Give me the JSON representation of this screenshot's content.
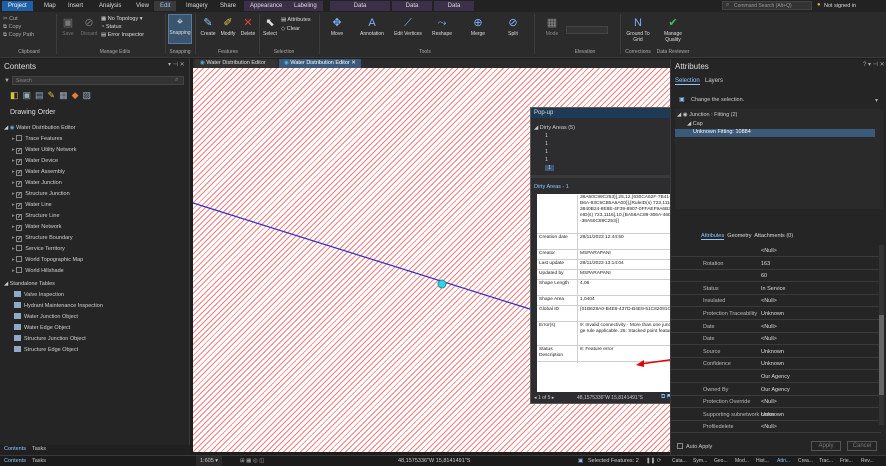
{
  "tabs": [
    "Project",
    "Map",
    "Insert",
    "Analysis",
    "View",
    "Edit",
    "Imagery",
    "Share",
    "Appearance",
    "Labeling",
    "Data",
    "Data",
    "Data"
  ],
  "search_placeholder": "Command Search (Alt+Q)",
  "user": "Not signed in",
  "ribbon": {
    "clipboard": {
      "items": [
        "Cut",
        "Copy",
        "Copy Path"
      ],
      "paste": "Paste",
      "label": "Clipboard"
    },
    "manage_edits": {
      "save": "Save",
      "discard": "Discard",
      "topology": "No Topology",
      "status": "Status",
      "error_inspector": "Error Inspector",
      "label": "Manage Edits"
    },
    "snapping": {
      "btn": "Snapping",
      "label": "Snapping"
    },
    "features": {
      "create": "Create",
      "modify": "Modify",
      "delete": "Delete",
      "label": "Features"
    },
    "selection": {
      "select": "Select",
      "attributes": "Attributes",
      "clear": "Clear",
      "label": "Selection"
    },
    "tools": {
      "items": [
        "Move",
        "Annotation",
        "Edit Vertices",
        "Reshape",
        "Merge",
        "Split"
      ],
      "label": "Tools"
    },
    "elevation": {
      "mode": "Mode",
      "label": "Elevation"
    },
    "corrections": {
      "ground": "Ground To Grid",
      "label": "Corrections"
    },
    "data_reviewer": {
      "manage": "Manage Quality",
      "label": "Data Reviewer"
    }
  },
  "contents": {
    "title": "Contents",
    "search_placeholder": "Search",
    "drawing_order": "Drawing Order",
    "map_name": "Water Distribution Editor",
    "layers": [
      {
        "name": "Trace Features",
        "checked": false
      },
      {
        "name": "Water Utility Network",
        "checked": true
      },
      {
        "name": "Water Device",
        "checked": true
      },
      {
        "name": "Water Assembly",
        "checked": true
      },
      {
        "name": "Water Junction",
        "checked": true
      },
      {
        "name": "Structure Junction",
        "checked": true
      },
      {
        "name": "Water Line",
        "checked": true
      },
      {
        "name": "Structure Line",
        "checked": true
      },
      {
        "name": "Water Network",
        "checked": true
      },
      {
        "name": "Structure Boundary",
        "checked": true
      },
      {
        "name": "Service Territory",
        "checked": false
      },
      {
        "name": "World Topographic Map",
        "checked": false
      },
      {
        "name": "World Hillshade",
        "checked": false
      }
    ],
    "standalone_title": "Standalone Tables",
    "tables": [
      "Valve Inspection",
      "Hydrant Maintenance Inspection",
      "Water Junction Object",
      "Water Edge Object",
      "Structure Junction Object",
      "Structure Edge Object"
    ],
    "bottom_tabs": [
      "Contents",
      "Tasks"
    ]
  },
  "map_tabs": [
    "Water Distribution Editor",
    "Water Distribution Editor"
  ],
  "popup": {
    "title": "Pop-up",
    "group": "Dirty Areas  (5)",
    "items": [
      "1",
      "1",
      "1",
      "1",
      "1"
    ],
    "section": "Dirty Areas - 1",
    "top_text": "38A50C89C253}],25,12,{630CA62F-7B41-4F52-8B6A-83C5CB5A6A00}],[RuleID(s) 723,1116],10,{E3840B24-8E8E-4F39-8907-0FFAEF9A6B3F}],[RuleID(s) 723,1116],10,{BA56AC89-306A-46DF-9027-38A50C89C253}]",
    "rows": [
      {
        "k": "Creation date",
        "v": "28/11/2023 12:44:50"
      },
      {
        "k": "Creator",
        "v": "MSPARAPANI"
      },
      {
        "k": "Last update",
        "v": "28/11/2023 13:14:04"
      },
      {
        "k": "Updated by",
        "v": "MSPARAPANI"
      },
      {
        "k": "Shape Length",
        "v": "4,06"
      },
      {
        "k": "Shape Area",
        "v": "1,0404"
      },
      {
        "k": "Global ID",
        "v": "{01B628A0-B4E6-437D-B4E9-51C82091C538}"
      },
      {
        "k": "Error(s)",
        "v": "9: Invalid connectivity - More than one junction edge rule applicable. 25: Stacked point features."
      },
      {
        "k": "Status Description",
        "v": "8: Feature error"
      }
    ],
    "nav": "1 of 5",
    "coords": "48,1575336\"W 15,8141491\"S"
  },
  "attributes": {
    "title": "Attributes",
    "tabs": [
      "Selection",
      "Layers"
    ],
    "change_selection": "Change the selection.",
    "tree": [
      "Junction : Fitting (2)",
      "Cap",
      "Unknown Fitting: 10884"
    ],
    "detail_tabs": [
      "Attributes",
      "Geometry",
      "Attachments (0)"
    ],
    "rows": [
      {
        "k": "",
        "v": "<Null>"
      },
      {
        "k": "Rotation",
        "v": "163"
      },
      {
        "k": "",
        "v": "60"
      },
      {
        "k": "Status",
        "v": "In Service"
      },
      {
        "k": "Insulated",
        "v": "<Null>"
      },
      {
        "k": "Protection Traceability",
        "v": "Unknown"
      },
      {
        "k": "Date",
        "v": "<Null>"
      },
      {
        "k": "Date",
        "v": "<Null>"
      },
      {
        "k": "Source",
        "v": "Unknown"
      },
      {
        "k": "Confidence",
        "v": "Unknown"
      },
      {
        "k": "",
        "v": "Our Agency"
      },
      {
        "k": "Owned By",
        "v": "Our Agency"
      },
      {
        "k": "Protection Override",
        "v": "<Null>"
      },
      {
        "k": "Supporting subnetwork name",
        "v": "Unknown"
      },
      {
        "k": "Profiledelete",
        "v": "<Null>"
      }
    ],
    "auto_apply": "Auto Apply",
    "apply": "Apply",
    "cancel": "Cancel",
    "bottom_tabs": [
      "Cata...",
      "Sym...",
      "Geo...",
      "Mod...",
      "Hist...",
      "Attri...",
      "Crea...",
      "Trac...",
      "Frie...",
      "Rev..."
    ]
  },
  "status": {
    "scale": "1:605",
    "coords": "48,1575336\"W 15,8141491\"S",
    "selected": "Selected Features: 2"
  },
  "colors": {
    "accent": "#1f5fa8",
    "hatch": "#f08080",
    "line": "#2a2ad0",
    "point": "#39d0e0",
    "error_arrow": "#e00000"
  }
}
